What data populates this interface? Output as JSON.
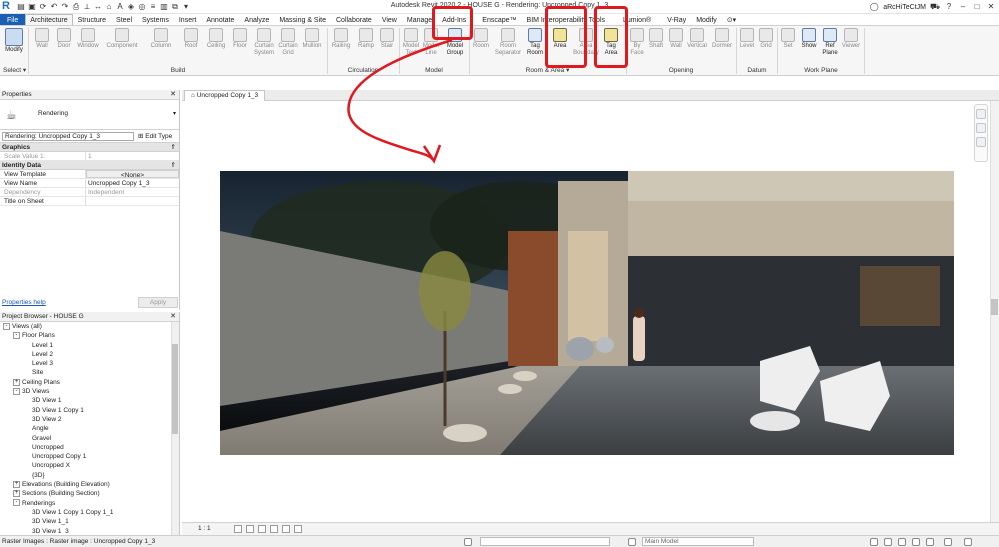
{
  "window": {
    "title": "Autodesk Revit 2020.2 - HOUSE G - Rendering: Uncropped Copy 1_3",
    "user": "aRcHiTeCtJM"
  },
  "tabs": [
    "File",
    "Architecture",
    "Structure",
    "Steel",
    "Systems",
    "Insert",
    "Annotate",
    "Analyze",
    "Massing & Site",
    "Collaborate",
    "View",
    "Manage",
    "Add-Ins",
    "Enscape™",
    "BIM Interoperability Tools",
    "Lumion®",
    "V-Ray",
    "Modify"
  ],
  "ribbon": {
    "modify": "Modify",
    "select": "Select",
    "build": [
      "Wall",
      "Door",
      "Window",
      "Component",
      "Column",
      "Roof",
      "Ceiling",
      "Floor",
      "Curtain System",
      "Curtain Grid",
      "Mullion"
    ],
    "circulation": [
      "Railing",
      "Ramp",
      "Stair"
    ],
    "model": [
      "Model Text",
      "Model Line",
      "Model Group"
    ],
    "room_area": [
      "Room",
      "Room Separator",
      "Tag Room",
      "Area",
      "Area Boundary",
      "Tag Area"
    ],
    "opening": [
      "By Face",
      "Shaft",
      "Wall",
      "Vertical",
      "Dormer"
    ],
    "datum": [
      "Level",
      "Grid"
    ],
    "work_plane": [
      "Set",
      "Show",
      "Ref Plane",
      "Viewer"
    ],
    "panels": {
      "build": "Build",
      "circulation": "Circulation",
      "model": "Model",
      "room_area": "Room & Area ▾",
      "opening": "Opening",
      "datum": "Datum",
      "work_plane": "Work Plane"
    }
  },
  "properties": {
    "title": "Properties",
    "type_name": "Rendering",
    "instance": "Rendering: Uncropped Copy 1_3",
    "edit_type": "Edit Type",
    "groups": {
      "graphics": "Graphics",
      "identity": "Identity Data"
    },
    "rows": {
      "scale_key": "Scale Value   1:",
      "scale_val": "1",
      "template_key": "View Template",
      "template_val": "<None>",
      "name_key": "View Name",
      "name_val": "Uncropped Copy 1_3",
      "dependency_key": "Dependency",
      "dependency_val": "Independent",
      "sheet_key": "Title on Sheet",
      "sheet_val": ""
    },
    "help": "Properties help",
    "apply": "Apply"
  },
  "browser": {
    "title": "Project Browser - HOUSE G",
    "nodes": [
      {
        "label": "Views (all)",
        "level": 0,
        "exp": "-"
      },
      {
        "label": "Floor Plans",
        "level": 1,
        "exp": "-"
      },
      {
        "label": "Level 1",
        "level": 2,
        "exp": ""
      },
      {
        "label": "Level 2",
        "level": 2,
        "exp": ""
      },
      {
        "label": "Level 3",
        "level": 2,
        "exp": ""
      },
      {
        "label": "Site",
        "level": 2,
        "exp": ""
      },
      {
        "label": "Ceiling Plans",
        "level": 1,
        "exp": "+"
      },
      {
        "label": "3D Views",
        "level": 1,
        "exp": "-"
      },
      {
        "label": "3D View 1",
        "level": 2,
        "exp": ""
      },
      {
        "label": "3D View 1 Copy 1",
        "level": 2,
        "exp": ""
      },
      {
        "label": "3D View 2",
        "level": 2,
        "exp": ""
      },
      {
        "label": "Angle",
        "level": 2,
        "exp": ""
      },
      {
        "label": "Gravel",
        "level": 2,
        "exp": ""
      },
      {
        "label": "Uncropped",
        "level": 2,
        "exp": ""
      },
      {
        "label": "Uncropped Copy 1",
        "level": 2,
        "exp": ""
      },
      {
        "label": "Uncropped X",
        "level": 2,
        "exp": ""
      },
      {
        "label": "{3D}",
        "level": 2,
        "exp": ""
      },
      {
        "label": "Elevations (Building Elevation)",
        "level": 1,
        "exp": "+"
      },
      {
        "label": "Sections (Building Section)",
        "level": 1,
        "exp": "+"
      },
      {
        "label": "Renderings",
        "level": 1,
        "exp": "-"
      },
      {
        "label": "3D View 1 Copy 1 Copy 1_1",
        "level": 2,
        "exp": ""
      },
      {
        "label": "3D View 1_1",
        "level": 2,
        "exp": ""
      },
      {
        "label": "3D View 1_3",
        "level": 2,
        "exp": ""
      }
    ]
  },
  "view": {
    "tab_label": "Uncropped Copy 1_3",
    "scale": "1 : 1"
  },
  "status": {
    "text": "Raster Images : Raster image : Uncropped Copy 1_3",
    "model": "Main Model"
  },
  "colors": {
    "file_tab": "#1b5fb5",
    "highlight": "#e0191f",
    "link": "#1a57b6"
  }
}
